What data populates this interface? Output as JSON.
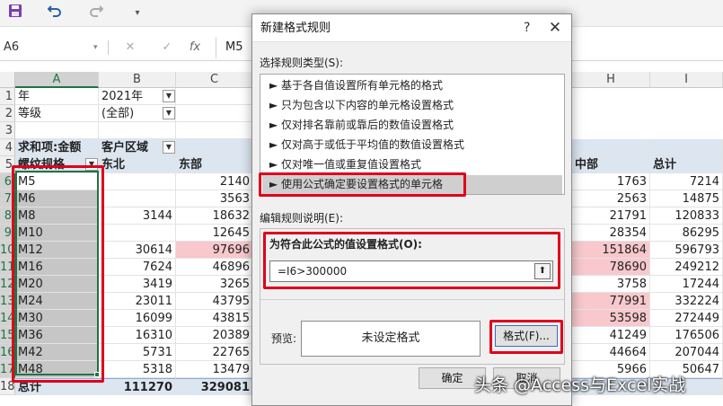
{
  "toolbar": {
    "save_icon": "save-icon",
    "undo_icon": "undo-icon",
    "redo_icon": "redo-icon",
    "customize_icon": "customize-icon"
  },
  "formula_bar": {
    "name_box": "A6",
    "cancel": "✕",
    "confirm": "✓",
    "fx": "fx",
    "content": "M5"
  },
  "columns": [
    "A",
    "B",
    "C",
    "H",
    "I"
  ],
  "row_numbers": [
    "1",
    "2",
    "3",
    "4",
    "5",
    "6",
    "7",
    "8",
    "9",
    "10",
    "11",
    "12",
    "13",
    "14",
    "15",
    "16",
    "17",
    "18"
  ],
  "pivot": {
    "filter_rows": [
      {
        "label": "年",
        "value": "2021年"
      },
      {
        "label": "等级",
        "value": "(全部)"
      }
    ],
    "header_row": {
      "a": "求和项:金额",
      "b": "客户区域"
    },
    "subheader_row": {
      "a": "螺纹规格",
      "b": "东北",
      "c": "东部",
      "h": "中部",
      "i": "总计"
    },
    "rows": [
      {
        "spec": "M5",
        "b": "",
        "c": "2140",
        "h": "1763",
        "i": "7214"
      },
      {
        "spec": "M6",
        "b": "",
        "c": "3563",
        "h": "2563",
        "i": "14875"
      },
      {
        "spec": "M8",
        "b": "3144",
        "c": "18632",
        "h": "21791",
        "i": "120833"
      },
      {
        "spec": "M10",
        "b": "",
        "c": "12645",
        "h": "28354",
        "i": "86295"
      },
      {
        "spec": "M12",
        "b": "30614",
        "c": "97696",
        "h": "151864",
        "i": "596793"
      },
      {
        "spec": "M16",
        "b": "7624",
        "c": "46896",
        "h": "78690",
        "i": "249212"
      },
      {
        "spec": "M20",
        "b": "3419",
        "c": "3265",
        "h": "3758",
        "i": "17244"
      },
      {
        "spec": "M24",
        "b": "23011",
        "c": "43795",
        "h": "77991",
        "i": "332224"
      },
      {
        "spec": "M30",
        "b": "16099",
        "c": "43815",
        "h": "53598",
        "i": "272449"
      },
      {
        "spec": "M36",
        "b": "16310",
        "c": "20389",
        "h": "41249",
        "i": "176506"
      },
      {
        "spec": "M42",
        "b": "5731",
        "c": "22765",
        "h": "44664",
        "i": "207044"
      },
      {
        "spec": "M48",
        "b": "5318",
        "c": "13479",
        "h": "5966",
        "i": "50647"
      }
    ],
    "total_row": {
      "label": "总计",
      "b": "111270",
      "c": "329081"
    }
  },
  "dialog": {
    "title": "新建格式规则",
    "help": "?",
    "close": "✕",
    "rule_type_label": "选择规则类型(S):",
    "rule_types": [
      "► 基于各自值设置所有单元格的格式",
      "► 只为包含以下内容的单元格设置格式",
      "► 仅对排名靠前或靠后的数值设置格式",
      "► 仅对高于或低于平均值的数值设置格式",
      "► 仅对唯一值或重复值设置格式",
      "► 使用公式确定要设置格式的单元格"
    ],
    "edit_label": "编辑规则说明(E):",
    "formula_label": "为符合此公式的值设置格式(O):",
    "formula_value": "=I6>300000",
    "collapse_icon": "⬆",
    "preview_label": "预览:",
    "preview_text": "未设定格式",
    "format_button": "格式(F)...",
    "ok_button": "确定",
    "cancel_button": "取消"
  },
  "watermark": "头条 @Access与Excel实战",
  "colors": {
    "highlight_red": "#e0001b",
    "conditional_pink": "#f8c8cc",
    "pivot_header": "#dce6f1",
    "excel_green": "#217346"
  }
}
